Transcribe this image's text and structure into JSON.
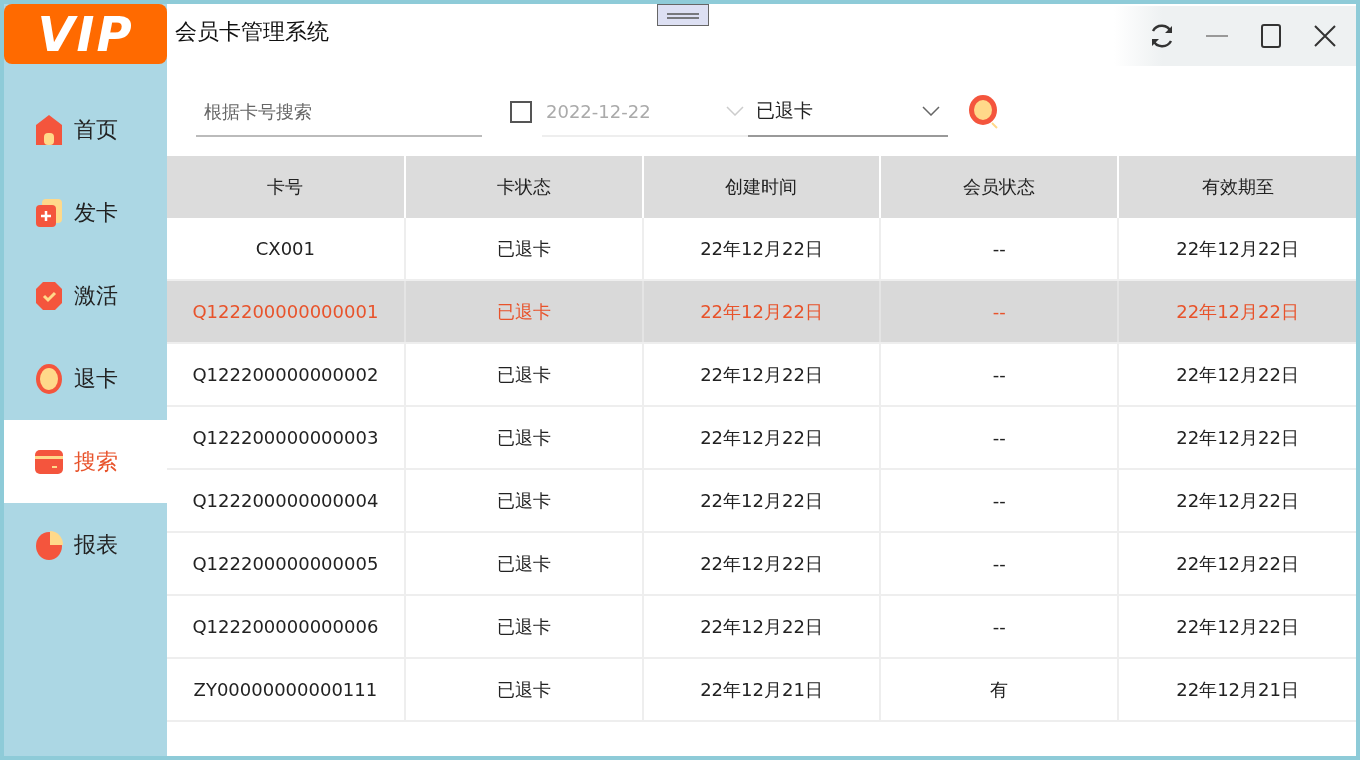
{
  "logo": "VIP",
  "window": {
    "title": "会员卡管理系统"
  },
  "sidebar": {
    "items": [
      {
        "label": "首页",
        "selected": false
      },
      {
        "label": "发卡",
        "selected": false
      },
      {
        "label": "激活",
        "selected": false
      },
      {
        "label": "退卡",
        "selected": false
      },
      {
        "label": "搜索",
        "selected": true
      },
      {
        "label": "报表",
        "selected": false
      }
    ]
  },
  "filters": {
    "search": {
      "placeholder": "根据卡号搜索"
    },
    "date": {
      "checked": false,
      "value": "2022-12-22"
    },
    "status": {
      "value": "已退卡"
    }
  },
  "table": {
    "columns": [
      "卡号",
      "卡状态",
      "创建时间",
      "会员状态",
      "有效期至"
    ],
    "rows": [
      {
        "cells": [
          "CX001",
          "已退卡",
          "22年12月22日",
          "--",
          "22年12月22日"
        ],
        "selected": false
      },
      {
        "cells": [
          "Q122200000000001",
          "已退卡",
          "22年12月22日",
          "--",
          "22年12月22日"
        ],
        "selected": true
      },
      {
        "cells": [
          "Q122200000000002",
          "已退卡",
          "22年12月22日",
          "--",
          "22年12月22日"
        ],
        "selected": false
      },
      {
        "cells": [
          "Q122200000000003",
          "已退卡",
          "22年12月22日",
          "--",
          "22年12月22日"
        ],
        "selected": false
      },
      {
        "cells": [
          "Q122200000000004",
          "已退卡",
          "22年12月22日",
          "--",
          "22年12月22日"
        ],
        "selected": false
      },
      {
        "cells": [
          "Q122200000000005",
          "已退卡",
          "22年12月22日",
          "--",
          "22年12月22日"
        ],
        "selected": false
      },
      {
        "cells": [
          "Q122200000000006",
          "已退卡",
          "22年12月22日",
          "--",
          "22年12月22日"
        ],
        "selected": false
      },
      {
        "cells": [
          "ZY00000000000111",
          "已退卡",
          "22年12月21日",
          "有",
          "22年12月21日"
        ],
        "selected": false
      }
    ]
  }
}
